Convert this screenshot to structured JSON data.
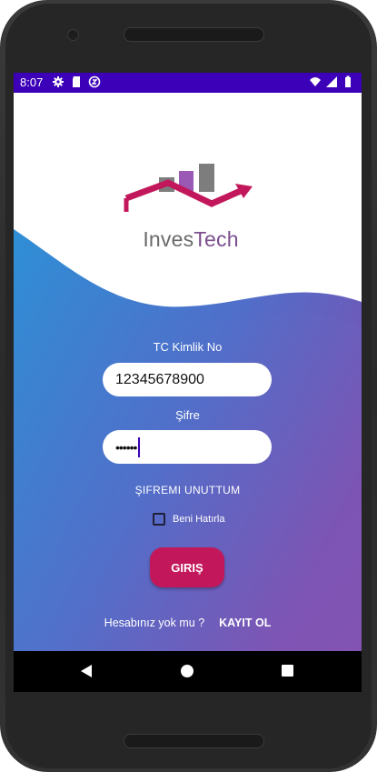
{
  "status_bar": {
    "time": "8:07",
    "left_icons": [
      "gear-icon",
      "sd-card-icon",
      "sync-icon"
    ],
    "right_icons": [
      "wifi-icon",
      "signal-icon",
      "battery-icon"
    ],
    "color": "#3c00b8"
  },
  "logo": {
    "text_part1": "Inves",
    "text_part2": "Tech",
    "colors": {
      "roof": "#c2185b",
      "bar_gray": "#7d7d7d",
      "bar_purple": "#9b59b6"
    }
  },
  "form": {
    "tc_label": "TC Kimlik No",
    "tc_value": "12345678900",
    "password_label": "Şifre",
    "password_value": "••••••",
    "forgot_label": "ŞIFREMI UNUTTUM",
    "remember_label": "Beni Hatırla",
    "remember_checked": false,
    "login_label": "GIRIŞ"
  },
  "footer": {
    "question": "Hesabınız yok mu ?",
    "register_label": "KAYIT OL"
  },
  "nav_bar": {
    "back": "back-icon",
    "home": "home-icon",
    "recents": "recents-icon"
  },
  "colors": {
    "accent": "#c2185b",
    "gradient_start": "#2f8fd6",
    "gradient_end": "#7e4fb0"
  }
}
